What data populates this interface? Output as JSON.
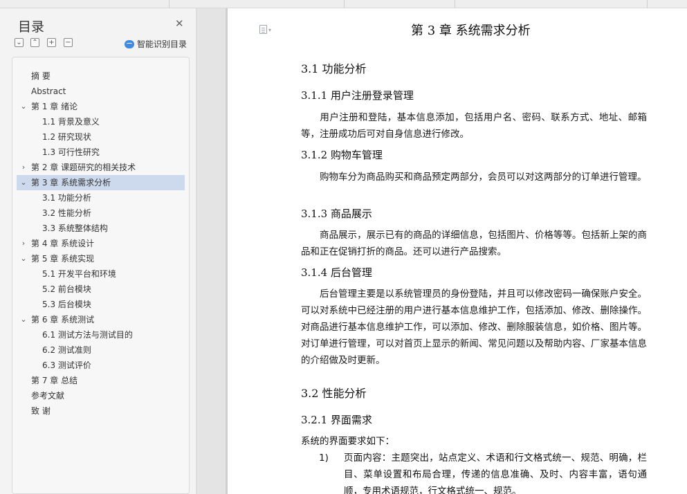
{
  "sidebar": {
    "title": "目录",
    "close_glyph": "✕",
    "tools": [
      {
        "name": "collapse-all-icon",
        "glyph": "⌄"
      },
      {
        "name": "collapse-up-icon",
        "glyph": "⌃"
      },
      {
        "name": "expand-icon",
        "glyph": "+"
      },
      {
        "name": "collapse-icon",
        "glyph": "−"
      }
    ],
    "smart_toc_label": "智能识别目录",
    "toc": [
      {
        "label": "摘  要",
        "level": 1,
        "arrow": ""
      },
      {
        "label": "Abstract",
        "level": 1,
        "arrow": ""
      },
      {
        "label": "第 1 章  绪论",
        "level": 1,
        "arrow": "⌄"
      },
      {
        "label": "1.1 背景及意义",
        "level": 2,
        "arrow": ""
      },
      {
        "label": "1.2  研究现状",
        "level": 2,
        "arrow": ""
      },
      {
        "label": "1.3  可行性研究",
        "level": 2,
        "arrow": ""
      },
      {
        "label": "第 2 章  课题研究的相关技术",
        "level": 1,
        "arrow": "›"
      },
      {
        "label": "第 3 章  系统需求分析",
        "level": 1,
        "arrow": "⌄",
        "selected": true
      },
      {
        "label": "3.1  功能分析",
        "level": 2,
        "arrow": ""
      },
      {
        "label": "3.2  性能分析",
        "level": 2,
        "arrow": ""
      },
      {
        "label": "3.3  系统整体结构",
        "level": 2,
        "arrow": ""
      },
      {
        "label": "第 4 章  系统设计",
        "level": 1,
        "arrow": "›"
      },
      {
        "label": "第 5 章  系统实现",
        "level": 1,
        "arrow": "⌄"
      },
      {
        "label": "5.1  开发平台和环境",
        "level": 2,
        "arrow": ""
      },
      {
        "label": "5.2  前台模块",
        "level": 2,
        "arrow": ""
      },
      {
        "label": "5.3  后台模块",
        "level": 2,
        "arrow": ""
      },
      {
        "label": "第 6 章  系统测试",
        "level": 1,
        "arrow": "⌄"
      },
      {
        "label": "6.1  测试方法与测试目的",
        "level": 2,
        "arrow": ""
      },
      {
        "label": "6.2  测试准则",
        "level": 2,
        "arrow": ""
      },
      {
        "label": "6.3  测试评价",
        "level": 2,
        "arrow": ""
      },
      {
        "label": "第 7 章  总结",
        "level": 1,
        "arrow": ""
      },
      {
        "label": "参考文献",
        "level": 1,
        "arrow": ""
      },
      {
        "label": "致  谢",
        "level": 1,
        "arrow": ""
      }
    ]
  },
  "document": {
    "chapter_title": "第 3 章  系统需求分析",
    "s31": "3.1  功能分析",
    "s311": "3.1.1  用户注册登录管理",
    "p311": "用户注册和登陆，基本信息添加，包括用户名、密码、联系方式、地址、邮箱等，注册成功后可对自身信息进行修改。",
    "s312": "3.1.2  购物车管理",
    "p312": "购物车分为商品购买和商品预定两部分，会员可以对这两部分的订单进行管理。",
    "s313": "3.1.3  商品展示",
    "p313": "商品展示，展示已有的商品的详细信息，包括图片、价格等等。包括新上架的商品和正在促销打折的商品。还可以进行产品搜索。",
    "s314": "3.1.4  后台管理",
    "p314": "后台管理主要是以系统管理员的身份登陆，并且可以修改密码一确保账户安全。可以对系统中已经注册的用户进行基本信息维护工作，包括添加、修改、删除操作。对商品进行基本信息维护工作，可以添加、修改、删除服装信息，如价格、图片等。对订单进行管理，可以对首页上显示的新闻、常见问题以及帮助内容、厂家基本信息的介绍做及时更新。",
    "s32": "3.2  性能分析",
    "s321": "3.2.1  界面需求",
    "p321": "系统的界面要求如下：",
    "list_num": "1)",
    "list_text": "页面内容：主题突出，站点定义、术语和行文格式统一、规范、明确，栏目、菜单设置和布局合理，传递的信息准确、及时、内容丰富，语句通顺，专用术语规范，行文格式统一、规范。"
  }
}
